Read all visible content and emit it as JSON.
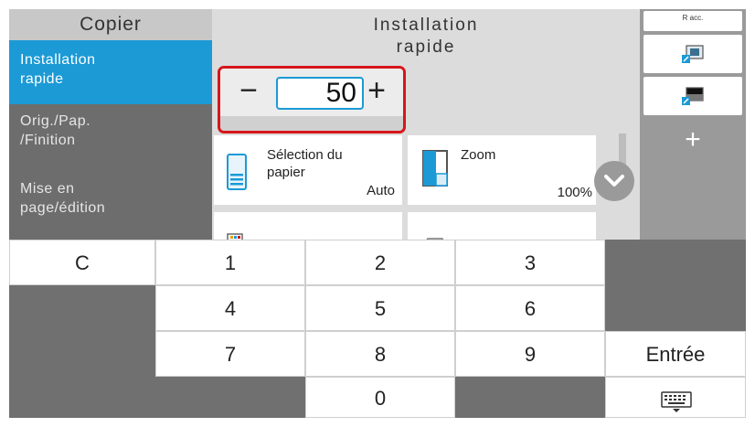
{
  "nav": {
    "title": "Copier",
    "items": [
      {
        "line1": "Installation",
        "line2": "rapide"
      },
      {
        "line1": "Orig./Pap.",
        "line2": "/Finition"
      },
      {
        "line1": "Mise en",
        "line2": "page/édition"
      }
    ]
  },
  "main": {
    "title_line1": "Installation",
    "title_line2": "rapide",
    "copies": {
      "minus": "−",
      "value": "50",
      "plus": "+"
    },
    "cards": [
      {
        "label_line1": "Sélection du",
        "label_line2": "papier",
        "value": "Auto"
      },
      {
        "label_line1": "Zoom",
        "label_line2": "",
        "value": "100%"
      }
    ]
  },
  "right": {
    "shortcut_label": "R acc.",
    "add": "+"
  },
  "keypad": {
    "clear": "C",
    "keys": [
      "1",
      "2",
      "3",
      "4",
      "5",
      "6",
      "7",
      "8",
      "9",
      "0"
    ],
    "enter": "Entrée"
  },
  "colors": {
    "accent": "#1b9ad6",
    "highlight": "#d7161c"
  },
  "icons": [
    "paper-tray-icon",
    "zoom-icon",
    "shortcut-1-icon",
    "shortcut-2-icon",
    "scroll-down-icon",
    "keyboard-icon"
  ]
}
